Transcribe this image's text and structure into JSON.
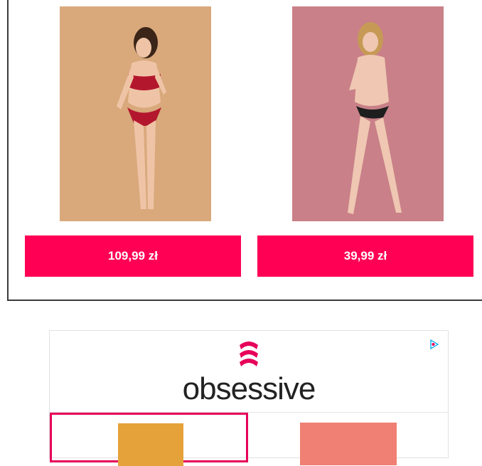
{
  "products": [
    {
      "price": "109,99 zł",
      "background": "#d9a97c"
    },
    {
      "price": "39,99 zł",
      "background": "#c98088"
    }
  ],
  "colors": {
    "accent": "#ff0055",
    "brand": "#e6005a"
  },
  "brand": {
    "name": "obsessive"
  },
  "icons": {
    "ad_choices": "ad-choices-icon"
  }
}
